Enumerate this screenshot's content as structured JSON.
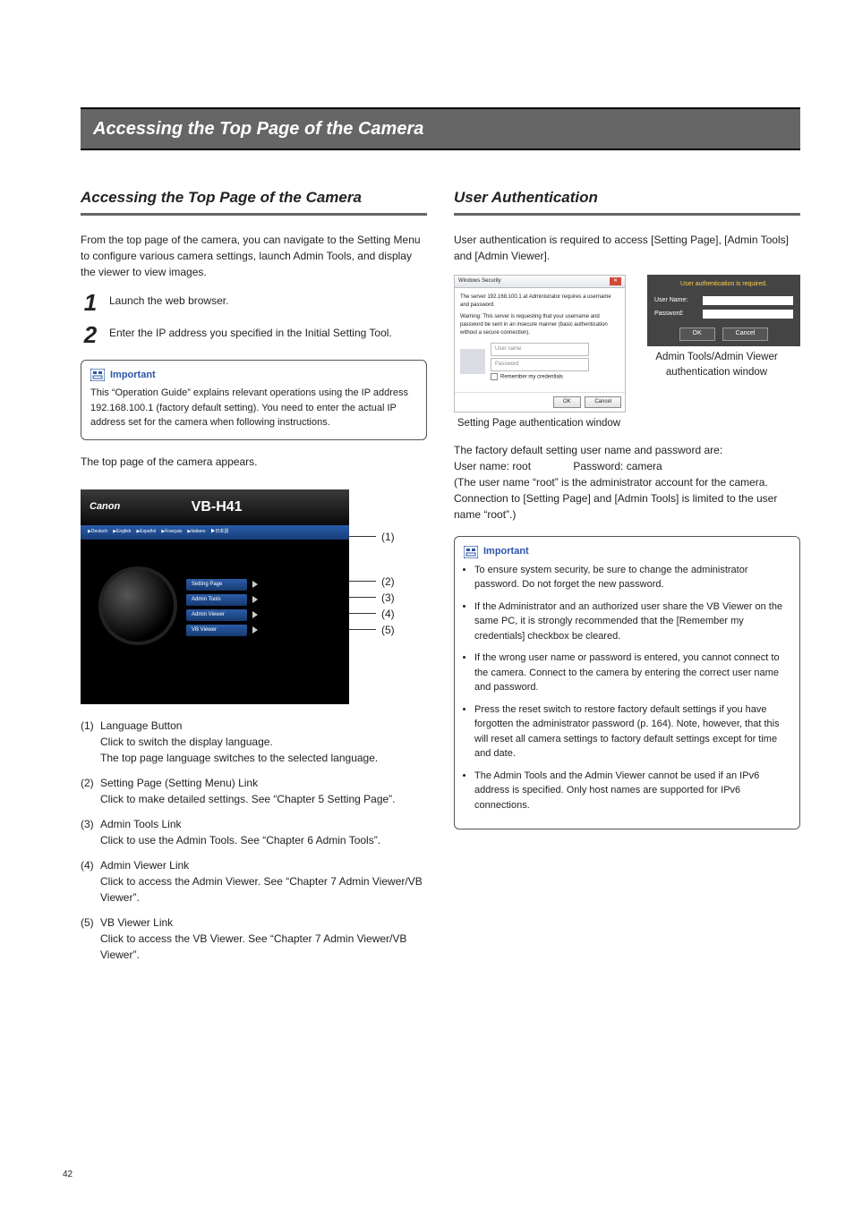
{
  "banner": {
    "title": "Accessing the Top Page of the Camera"
  },
  "left": {
    "heading": "Accessing the Top Page of the Camera",
    "intro": "From the top page of the camera, you can navigate to the Setting Menu to configure various camera settings, launch Admin Tools, and display the viewer to view images.",
    "steps": {
      "s1": {
        "num": "1",
        "text": "Launch the web browser."
      },
      "s2": {
        "num": "2",
        "text": "Enter the IP address you specified in the Initial Setting Tool."
      }
    },
    "important": {
      "label": "Important",
      "text": "This “Operation Guide” explains relevant operations using the IP address 192.168.100.1 (factory default setting). You need to enter the actual IP address set for the camera when following instructions."
    },
    "appears": "The top page of the camera appears.",
    "mock": {
      "logo": "Canon",
      "model": "VB-H41",
      "langs": {
        "de": "▶Deutsch",
        "en": "▶English",
        "es": "▶Español",
        "fr": "▶Français",
        "it": "▶Italiano",
        "jp": "▶日本語"
      },
      "menu": {
        "m1": "Setting Page",
        "m2": "Admin Tools",
        "m3": "Admin Viewer",
        "m4": "VB Viewer"
      },
      "labels": {
        "c1": "(1)",
        "c2": "(2)",
        "c3": "(3)",
        "c4": "(4)",
        "c5": "(5)"
      }
    },
    "defs": {
      "d1": {
        "num": "(1)",
        "title": "Language Button",
        "body": "Click to switch the display language.\nThe top page language switches to the selected language."
      },
      "d2": {
        "num": "(2)",
        "title": "Setting Page (Setting Menu) Link",
        "body": "Click to make detailed settings. See “Chapter 5 Setting Page”."
      },
      "d3": {
        "num": "(3)",
        "title": "Admin Tools Link",
        "body": "Click to use the Admin Tools. See “Chapter 6 Admin Tools”."
      },
      "d4": {
        "num": "(4)",
        "title": "Admin Viewer Link",
        "body": "Click to access the Admin Viewer. See “Chapter 7 Admin Viewer/VB Viewer”."
      },
      "d5": {
        "num": "(5)",
        "title": "VB Viewer Link",
        "body": "Click to access the VB Viewer. See “Chapter 7 Admin Viewer/VB Viewer”."
      }
    }
  },
  "right": {
    "heading": "User Authentication",
    "intro": "User authentication is required to access [Setting Page], [Admin Tools] and [Admin Viewer].",
    "win_sec": {
      "title": "Windows Security",
      "line1": "The server 192.168.100.1 at Administrator requires a username and password.",
      "line2": "Warning: This server is requesting that your username and password be sent in an insecure manner (basic authentication without a secure connection).",
      "user_ph": "User name",
      "pass_ph": "Password",
      "remember": "Remember my credentials",
      "ok": "OK",
      "cancel": "Cancel",
      "caption": "Setting Page authentication window"
    },
    "win_dark": {
      "hdr": "User authentication is required.",
      "name_lbl": "User Name:",
      "pass_lbl": "Password:",
      "ok": "OK",
      "cancel": "Cancel",
      "caption": "Admin Tools/Admin Viewer authentication window"
    },
    "creds": {
      "line1": "The factory default setting user name and password are:",
      "line2a": "User name: root",
      "line2b": "Password: camera",
      "line3": "(The user name “root” is the administrator account for the camera. Connection to [Setting Page] and [Admin Tools] is limited to the user name “root”.)"
    },
    "imp": {
      "label": "Important",
      "b1": "To ensure system security, be sure to change the administrator password. Do not forget the new password.",
      "b2": "If the Administrator and an authorized user share the VB Viewer on the same PC, it is strongly recommended that the [Remember my credentials] checkbox be cleared.",
      "b3": "If the wrong user name or password is entered, you cannot connect to the camera. Connect to the camera by entering the correct user name and password.",
      "b4": "Press the reset switch to restore factory default settings if you have forgotten the administrator password (p. 164). Note, however, that this will reset all camera settings to factory default settings except for time and date.",
      "b5": "The Admin Tools and the Admin Viewer cannot be used if an IPv6 address is specified. Only host names are supported for IPv6 connections."
    }
  },
  "page_number": "42"
}
